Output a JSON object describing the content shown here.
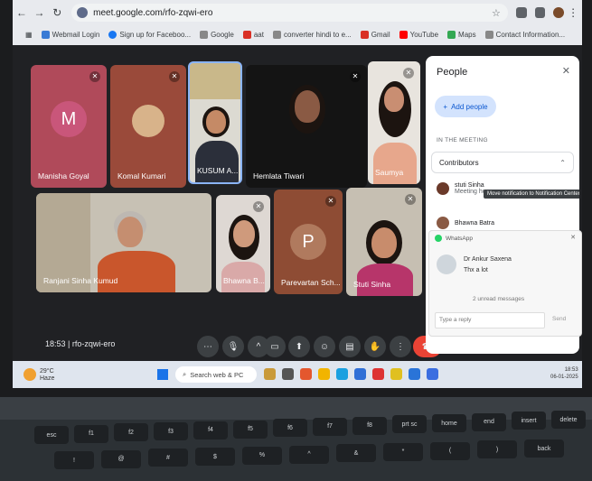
{
  "browser": {
    "url": "meet.google.com/rfo-zqwi-ero",
    "bookmarks": [
      {
        "label": "Webmail Login",
        "color": "#3a7bd5"
      },
      {
        "label": "Sign up for Faceboo...",
        "color": "#1877f2"
      },
      {
        "label": "Google",
        "color": "#888888"
      },
      {
        "label": "aat",
        "color": "#d93025"
      },
      {
        "label": "converter hindi to e...",
        "color": "#888888"
      },
      {
        "label": "Gmail",
        "color": "#d93025"
      },
      {
        "label": "YouTube",
        "color": "#ff0000"
      },
      {
        "label": "Maps",
        "color": "#34a853"
      },
      {
        "label": "Contact Information...",
        "color": "#888888"
      }
    ]
  },
  "participants": {
    "manisha": {
      "name": "Manisha Goyal",
      "initial": "M"
    },
    "komal": {
      "name": "Komal Kumari"
    },
    "kusum": {
      "name": "KUSUM A..."
    },
    "hemlata": {
      "name": "Hemlata Tiwari"
    },
    "saumya": {
      "name": "Saumya"
    },
    "ranjani": {
      "name": "Ranjani Sinha Kumud"
    },
    "bhawna": {
      "name": "Bhawna B..."
    },
    "parevartan": {
      "name": "Parevartan Sch...",
      "initial": "P"
    },
    "stuti": {
      "name": "Stuti Sinha"
    }
  },
  "meeting": {
    "time": "18:53",
    "separator": "|",
    "code": "rfo-zqwi-ero"
  },
  "people_panel": {
    "title": "People",
    "add_people": "Add people",
    "section": "IN THE MEETING",
    "group": "Contributors",
    "person1_name": "stuti Sinha",
    "person1_sub": "Meeting ho",
    "person2_name": "Bhawna Batra",
    "tooltip": "Move notification to Notification Center"
  },
  "whatsapp": {
    "app": "WhatsApp",
    "sender": "Dr Ankur Saxena",
    "message": "Thx a lot",
    "unread": "2 unread messages",
    "reply_placeholder": "Type a reply",
    "send": "Send"
  },
  "taskbar": {
    "temp": "29°C",
    "condition": "Haze",
    "search": "Search web & PC",
    "time": "18:53",
    "date": "06-01-2025"
  },
  "keyboard": {
    "keys": [
      "esc",
      "f1",
      "f2",
      "f3",
      "f4",
      "f5",
      "f6",
      "f7",
      "f8",
      "prt sc",
      "home",
      "end",
      "insert",
      "delete",
      "!",
      "@",
      "#",
      "$",
      "%",
      "^",
      "&",
      "*",
      "(",
      ")",
      "back"
    ]
  }
}
